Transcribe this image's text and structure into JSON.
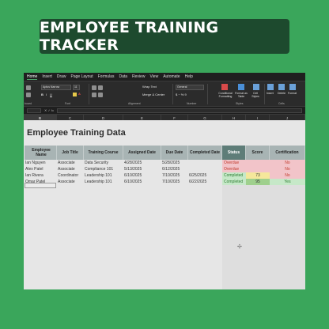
{
  "banner": {
    "title": "EMPLOYEE TRAINING TRACKER"
  },
  "menu": {
    "tabs": [
      "Home",
      "Insert",
      "Draw",
      "Page Layout",
      "Formulas",
      "Data",
      "Review",
      "View",
      "Automate",
      "Help"
    ]
  },
  "ribbon": {
    "font_name": "Aptos Narrow",
    "font_size": "11",
    "wrap_text": "Wrap Text",
    "merge_center": "Merge & Center",
    "number_format": "General",
    "conditional_formatting": "Conditional Formatting",
    "format_as_table": "Format as Table",
    "cell_styles": "Cell Styles",
    "insert": "Insert",
    "delete": "Delete",
    "format": "Format",
    "groups": {
      "clipboard": "board",
      "font": "Font",
      "alignment": "Alignment",
      "number": "Number",
      "styles": "Styles",
      "cells": "Cells"
    }
  },
  "formula_bar": {
    "fx": "✕ ✓ fx"
  },
  "columns": [
    "B",
    "C",
    "D",
    "E",
    "F",
    "G",
    "H",
    "I",
    "J",
    "K",
    "L"
  ],
  "sheet": {
    "title": "Employee Training Data",
    "headers": [
      "Employee Name",
      "Job Title",
      "Training Course",
      "Assigned Date",
      "Due Date",
      "Completed Date",
      "Status",
      "Score",
      "Certification"
    ],
    "rows": [
      {
        "name": "Ian Nguyen",
        "job": "Associate",
        "course": "Data Security",
        "assigned": "4/28/2025",
        "due": "5/28/2025",
        "completed": "",
        "status": "Overdue",
        "score": "",
        "cert": "No",
        "status_color": "red",
        "score_color": "red",
        "cert_color": "red"
      },
      {
        "name": "Alex Patel",
        "job": "Associate",
        "course": "Compliance 101",
        "assigned": "5/13/2025",
        "due": "6/12/2025",
        "completed": "",
        "status": "Overdue",
        "score": "",
        "cert": "No",
        "status_color": "red",
        "score_color": "red",
        "cert_color": "red"
      },
      {
        "name": "Ian Rivera",
        "job": "Coordinator",
        "course": "Leadership 101",
        "assigned": "6/10/2025",
        "due": "7/10/2025",
        "completed": "6/25/2025",
        "status": "Completed",
        "score": "73",
        "cert": "No",
        "status_color": "green",
        "score_color": "yellow",
        "cert_color": "red"
      },
      {
        "name": "Omar Patel",
        "job": "Associate",
        "course": "Leadership 101",
        "assigned": "6/10/2025",
        "due": "7/10/2025",
        "completed": "6/22/2025",
        "status": "Completed",
        "score": "95",
        "cert": "Yes",
        "status_color": "green",
        "score_color": "olive",
        "cert_color": "green"
      }
    ]
  }
}
